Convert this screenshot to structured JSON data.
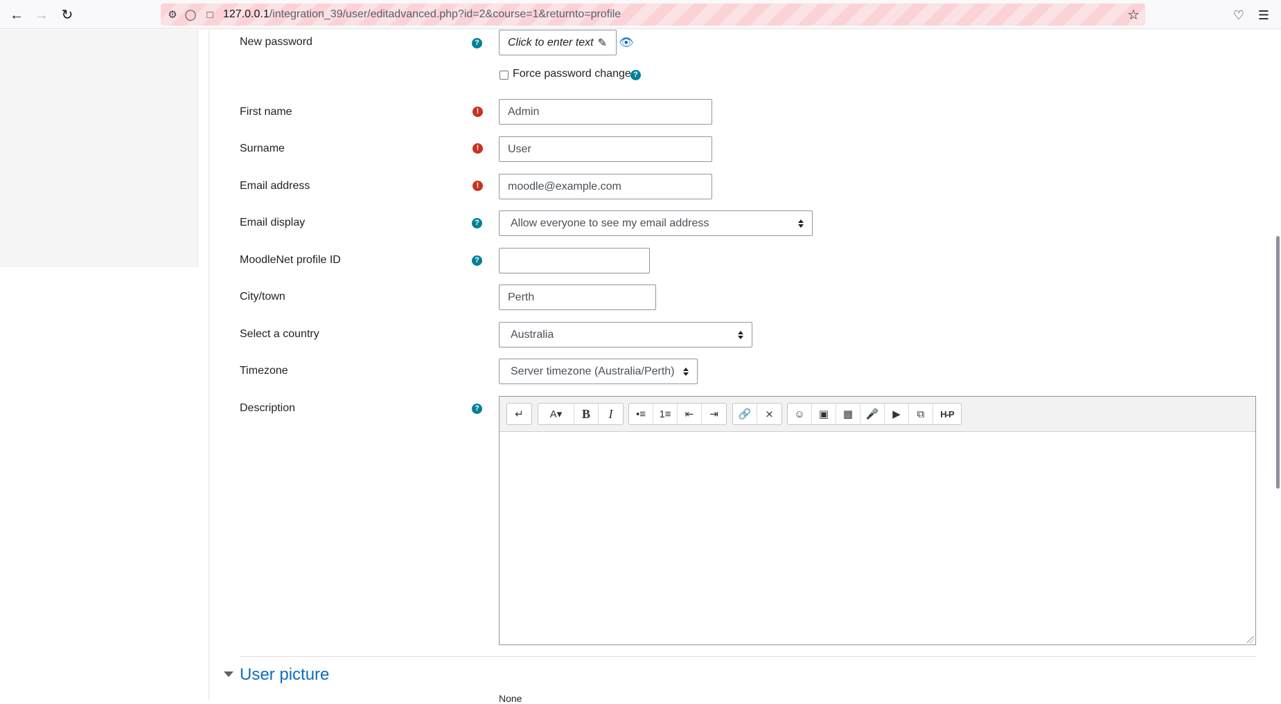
{
  "browser": {
    "url_host": "127.0.0.1",
    "url_path": "/integration_39/user/editadvanced.php?id=2&course=1&returnto=profile"
  },
  "form": {
    "new_password": {
      "label": "New password",
      "value": "Click to enter text"
    },
    "force_password_change": {
      "label": "Force password change",
      "checked": false
    },
    "first_name": {
      "label": "First name",
      "value": "Admin"
    },
    "surname": {
      "label": "Surname",
      "value": "User"
    },
    "email": {
      "label": "Email address",
      "value": "moodle@example.com"
    },
    "email_display": {
      "label": "Email display",
      "value": "Allow everyone to see my email address"
    },
    "moodlenet": {
      "label": "MoodleNet profile ID",
      "value": ""
    },
    "city": {
      "label": "City/town",
      "value": "Perth"
    },
    "country": {
      "label": "Select a country",
      "value": "Australia"
    },
    "timezone": {
      "label": "Timezone",
      "value": "Server timezone (Australia/Perth)"
    },
    "description": {
      "label": "Description",
      "value": ""
    }
  },
  "sections": {
    "user_picture": {
      "title": "User picture",
      "partial_text": "None"
    }
  },
  "colors": {
    "link": "#0f6cbf",
    "required": "#ca3120",
    "help": "#008196"
  }
}
